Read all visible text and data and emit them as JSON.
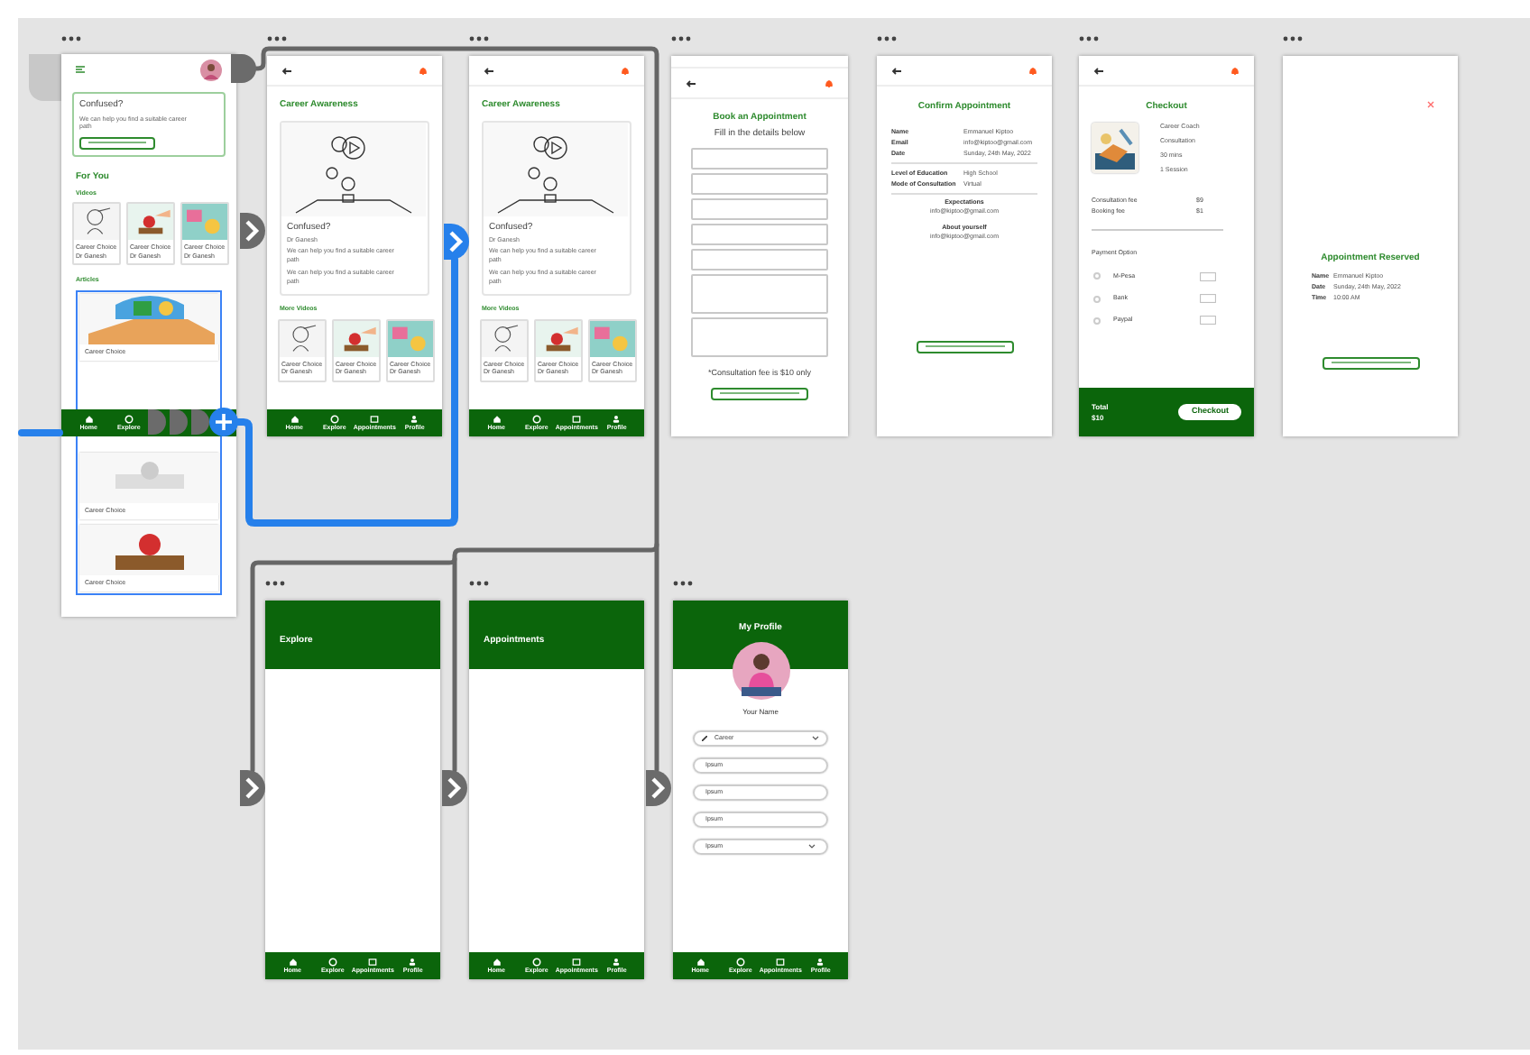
{
  "home": {
    "card": {
      "title": "Confused?",
      "body": "We can help you find a suitable career path"
    },
    "for_you": "For You",
    "videos_label": "Videos",
    "videos": [
      {
        "title": "Career Choice",
        "author": "Dr Ganesh"
      },
      {
        "title": "Career Choice",
        "author": "Dr Ganesh"
      },
      {
        "title": "Career Choice",
        "author": "Dr Ganesh"
      }
    ],
    "articles_label": "Articles",
    "articles": [
      {
        "title": "Career Choice"
      },
      {
        "title": "Career Choice"
      },
      {
        "title": "Career Choice"
      }
    ],
    "nav": [
      "Home",
      "Explore"
    ]
  },
  "career_awareness": [
    {
      "title": "Career Awareness",
      "video_title": "Confused?",
      "author": "Dr Ganesh",
      "paragraphs": [
        "We can help you find a suitable career path",
        "We can help you find a suitable career path"
      ],
      "more_label": "More Videos",
      "videos": [
        {
          "title": "Career Choice",
          "author": "Dr Ganesh"
        },
        {
          "title": "Career Choice",
          "author": "Dr Ganesh"
        },
        {
          "title": "Career Choice",
          "author": "Dr Ganesh"
        }
      ],
      "nav": [
        "Home",
        "Explore",
        "Appointments",
        "Profile"
      ]
    },
    {
      "title": "Career Awareness",
      "video_title": "Confused?",
      "author": "Dr Ganesh",
      "paragraphs": [
        "We can help you find a suitable career path",
        "We can help you find a suitable career path"
      ],
      "more_label": "More Videos",
      "videos": [
        {
          "title": "Career Choice",
          "author": "Dr Ganesh"
        },
        {
          "title": "Career Choice",
          "author": "Dr Ganesh"
        },
        {
          "title": "Career Choice",
          "author": "Dr Ganesh"
        }
      ],
      "nav": [
        "Home",
        "Explore",
        "Appointments",
        "Profile"
      ]
    }
  ],
  "book": {
    "title": "Book an Appointment",
    "subtitle": "Fill in the details below",
    "fields": [
      {
        "kind": "input"
      },
      {
        "kind": "input"
      },
      {
        "kind": "input"
      },
      {
        "kind": "input"
      },
      {
        "kind": "input"
      },
      {
        "kind": "textarea"
      },
      {
        "kind": "textarea"
      }
    ],
    "note": "*Consultation fee is $10 only"
  },
  "confirm": {
    "title": "Confirm Appointment",
    "rows": [
      {
        "label": "Name",
        "value": "Emmanuel Kiptoo"
      },
      {
        "label": "Email",
        "value": "info@kiptoo@gmail.com"
      },
      {
        "label": "Date",
        "value": "Sunday, 24th May, 2022"
      }
    ],
    "rows2": [
      {
        "label": "Level of Education",
        "value": "High School"
      },
      {
        "label": "Mode of Consultation",
        "value": "Virtual"
      }
    ],
    "sections": [
      {
        "label": "Expectations",
        "value": "info@kiptoo@gmail.com"
      },
      {
        "label": "About yourself",
        "value": "info@kiptoo@gmail.com"
      }
    ]
  },
  "checkout": {
    "title": "Checkout",
    "details": [
      "Career Coach",
      "Consultation",
      "30 mins",
      "1 Session"
    ],
    "fees": [
      {
        "label": "Consultation fee",
        "value": "$9"
      },
      {
        "label": "Booking fee",
        "value": "$1"
      }
    ],
    "payment_label": "Payment Option",
    "options": [
      {
        "label": "M-Pesa",
        "selected": false
      },
      {
        "label": "Bank",
        "selected": false
      },
      {
        "label": "Paypal",
        "selected": false
      }
    ],
    "total_label": "Total",
    "total": "$10",
    "button": "Checkout"
  },
  "reserved": {
    "title": "Appointment Reserved",
    "rows": [
      {
        "label": "Name",
        "value": "Emmanuel Kiptoo"
      },
      {
        "label": "Date",
        "value": "Sunday, 24th May, 2022"
      },
      {
        "label": "Time",
        "value": "10:00 AM"
      }
    ]
  },
  "explore": {
    "title": "Explore",
    "nav": [
      "Home",
      "Explore",
      "Appointments",
      "Profile"
    ]
  },
  "appointments": {
    "title": "Appointments",
    "nav": [
      "Home",
      "Explore",
      "Appointments",
      "Profile"
    ]
  },
  "profile": {
    "title": "My Profile",
    "name": "Your Name",
    "select": "Career",
    "fields": [
      {
        "value": "Ipsum",
        "kind": "input"
      },
      {
        "value": "Ipsum",
        "kind": "input"
      },
      {
        "value": "Ipsum",
        "kind": "input"
      },
      {
        "value": "Ipsum",
        "kind": "select"
      }
    ],
    "nav": [
      "Home",
      "Explore",
      "Appointments",
      "Profile"
    ]
  }
}
